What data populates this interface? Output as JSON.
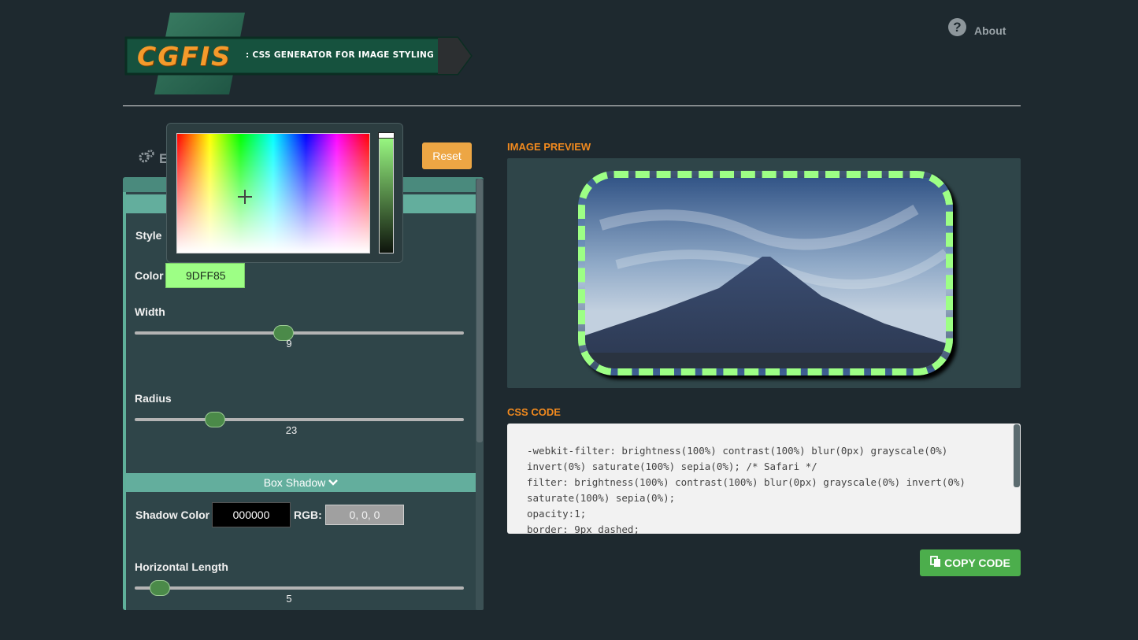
{
  "header": {
    "logo_text": "CGFIS",
    "logo_subtitle": ": CSS GENERATOR FOR IMAGE STYLING",
    "about_label": "About"
  },
  "left_panel": {
    "heading_partial": "E",
    "reset_label": "Reset",
    "border": {
      "style_label": "Style",
      "color_label": "Color",
      "color_value": "9DFF85",
      "width_label": "Width",
      "width_value": "9",
      "radius_label": "Radius",
      "radius_value": "23"
    },
    "box_shadow": {
      "section_label": "Box Shadow",
      "shadow_color_label": "Shadow Color",
      "shadow_color_value": "000000",
      "rgb_label": "RGB:",
      "rgb_value": "0, 0, 0",
      "horizontal_length_label": "Horizontal Length",
      "horizontal_length_value": "5"
    }
  },
  "picker": {
    "selected_hex": "#9dff85"
  },
  "preview": {
    "title": "IMAGE PREVIEW"
  },
  "code": {
    "title": "CSS CODE",
    "text": "-webkit-filter: brightness(100%) contrast(100%) blur(0px) grayscale(0%)\ninvert(0%) saturate(100%) sepia(0%); /* Safari */\nfilter: brightness(100%) contrast(100%) blur(0px) grayscale(0%) invert(0%)\nsaturate(100%) sepia(0%);\nopacity:1;\nborder: 9px dashed;",
    "copy_label": "COPY CODE"
  },
  "colors": {
    "accent_orange": "#f28a1e",
    "reset_orange": "#eda644",
    "green_button": "#4cae4c",
    "border_green": "#9dff85",
    "panel_teal": "#63ae9d"
  }
}
